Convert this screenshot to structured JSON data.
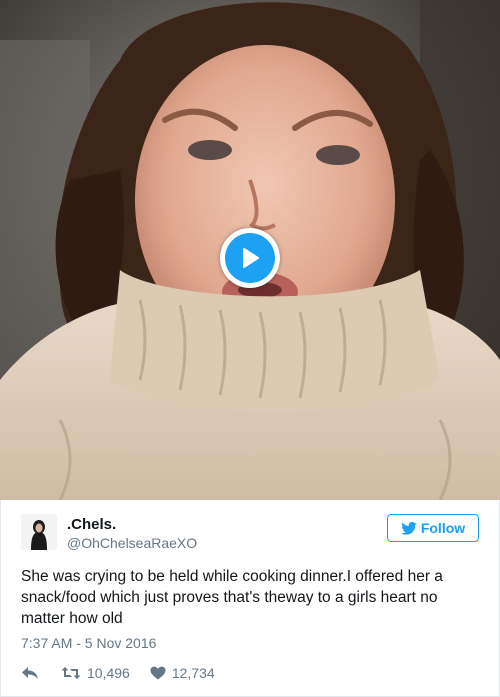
{
  "media": {
    "type": "video",
    "play_icon": "play-icon",
    "accent_color": "#1da1f2"
  },
  "tweet": {
    "display_name": ".Chels.",
    "handle": "@OhChelseaRaeXO",
    "follow_label": "Follow",
    "text": "She was crying to be held while cooking dinner.I offered her a snack/food which just proves that's theway to a girls heart no matter how old",
    "timestamp": "7:37 AM - 5 Nov 2016",
    "actions": {
      "reply_icon": "reply-icon",
      "retweet_icon": "retweet-icon",
      "retweet_count": "10,496",
      "like_icon": "heart-icon",
      "like_count": "12,734"
    }
  }
}
